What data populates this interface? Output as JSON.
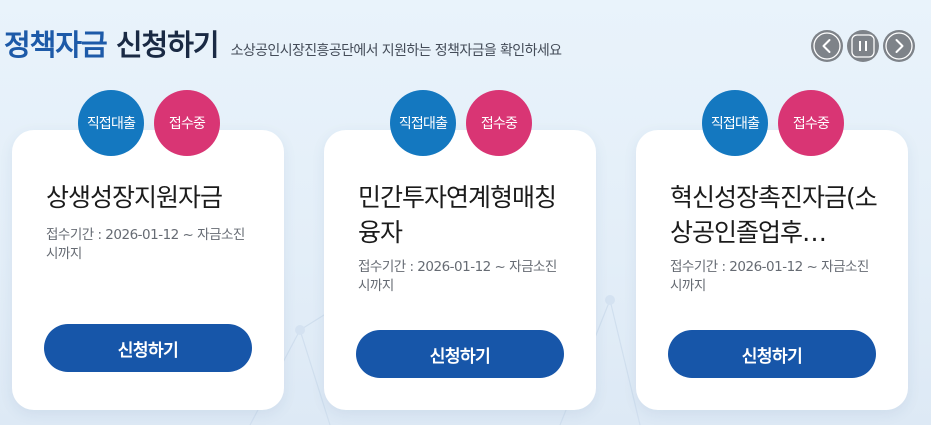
{
  "header": {
    "title_accent": "정책자금",
    "title_rest": "신청하기",
    "subtitle": "소상공인시장진흥공단에서 지원하는 정책자금을 확인하세요"
  },
  "controls": {
    "prev_icon": "chevron-left-icon",
    "pause_icon": "pause-icon",
    "next_icon": "chevron-right-icon"
  },
  "colors": {
    "accent": "#1d5aa8",
    "button": "#1756a9",
    "badge_direct": "#1478c0",
    "badge_status": "#d93574",
    "control": "#7e8389"
  },
  "cards": [
    {
      "badge_type": "직접대출",
      "badge_status": "접수중",
      "title": "상생성장지원자금",
      "period": "접수기간 : 2026-01-12 ~ 자금소진시까지",
      "button_label": "신청하기"
    },
    {
      "badge_type": "직접대출",
      "badge_status": "접수중",
      "title": "민간투자연계형매칭융자",
      "period": "접수기간 : 2026-01-12 ~ 자금소진시까지",
      "button_label": "신청하기"
    },
    {
      "badge_type": "직접대출",
      "badge_status": "접수중",
      "title": "혁신성장촉진자금(소상공인졸업후…",
      "period": "접수기간 : 2026-01-12 ~ 자금소진시까지",
      "button_label": "신청하기"
    }
  ]
}
